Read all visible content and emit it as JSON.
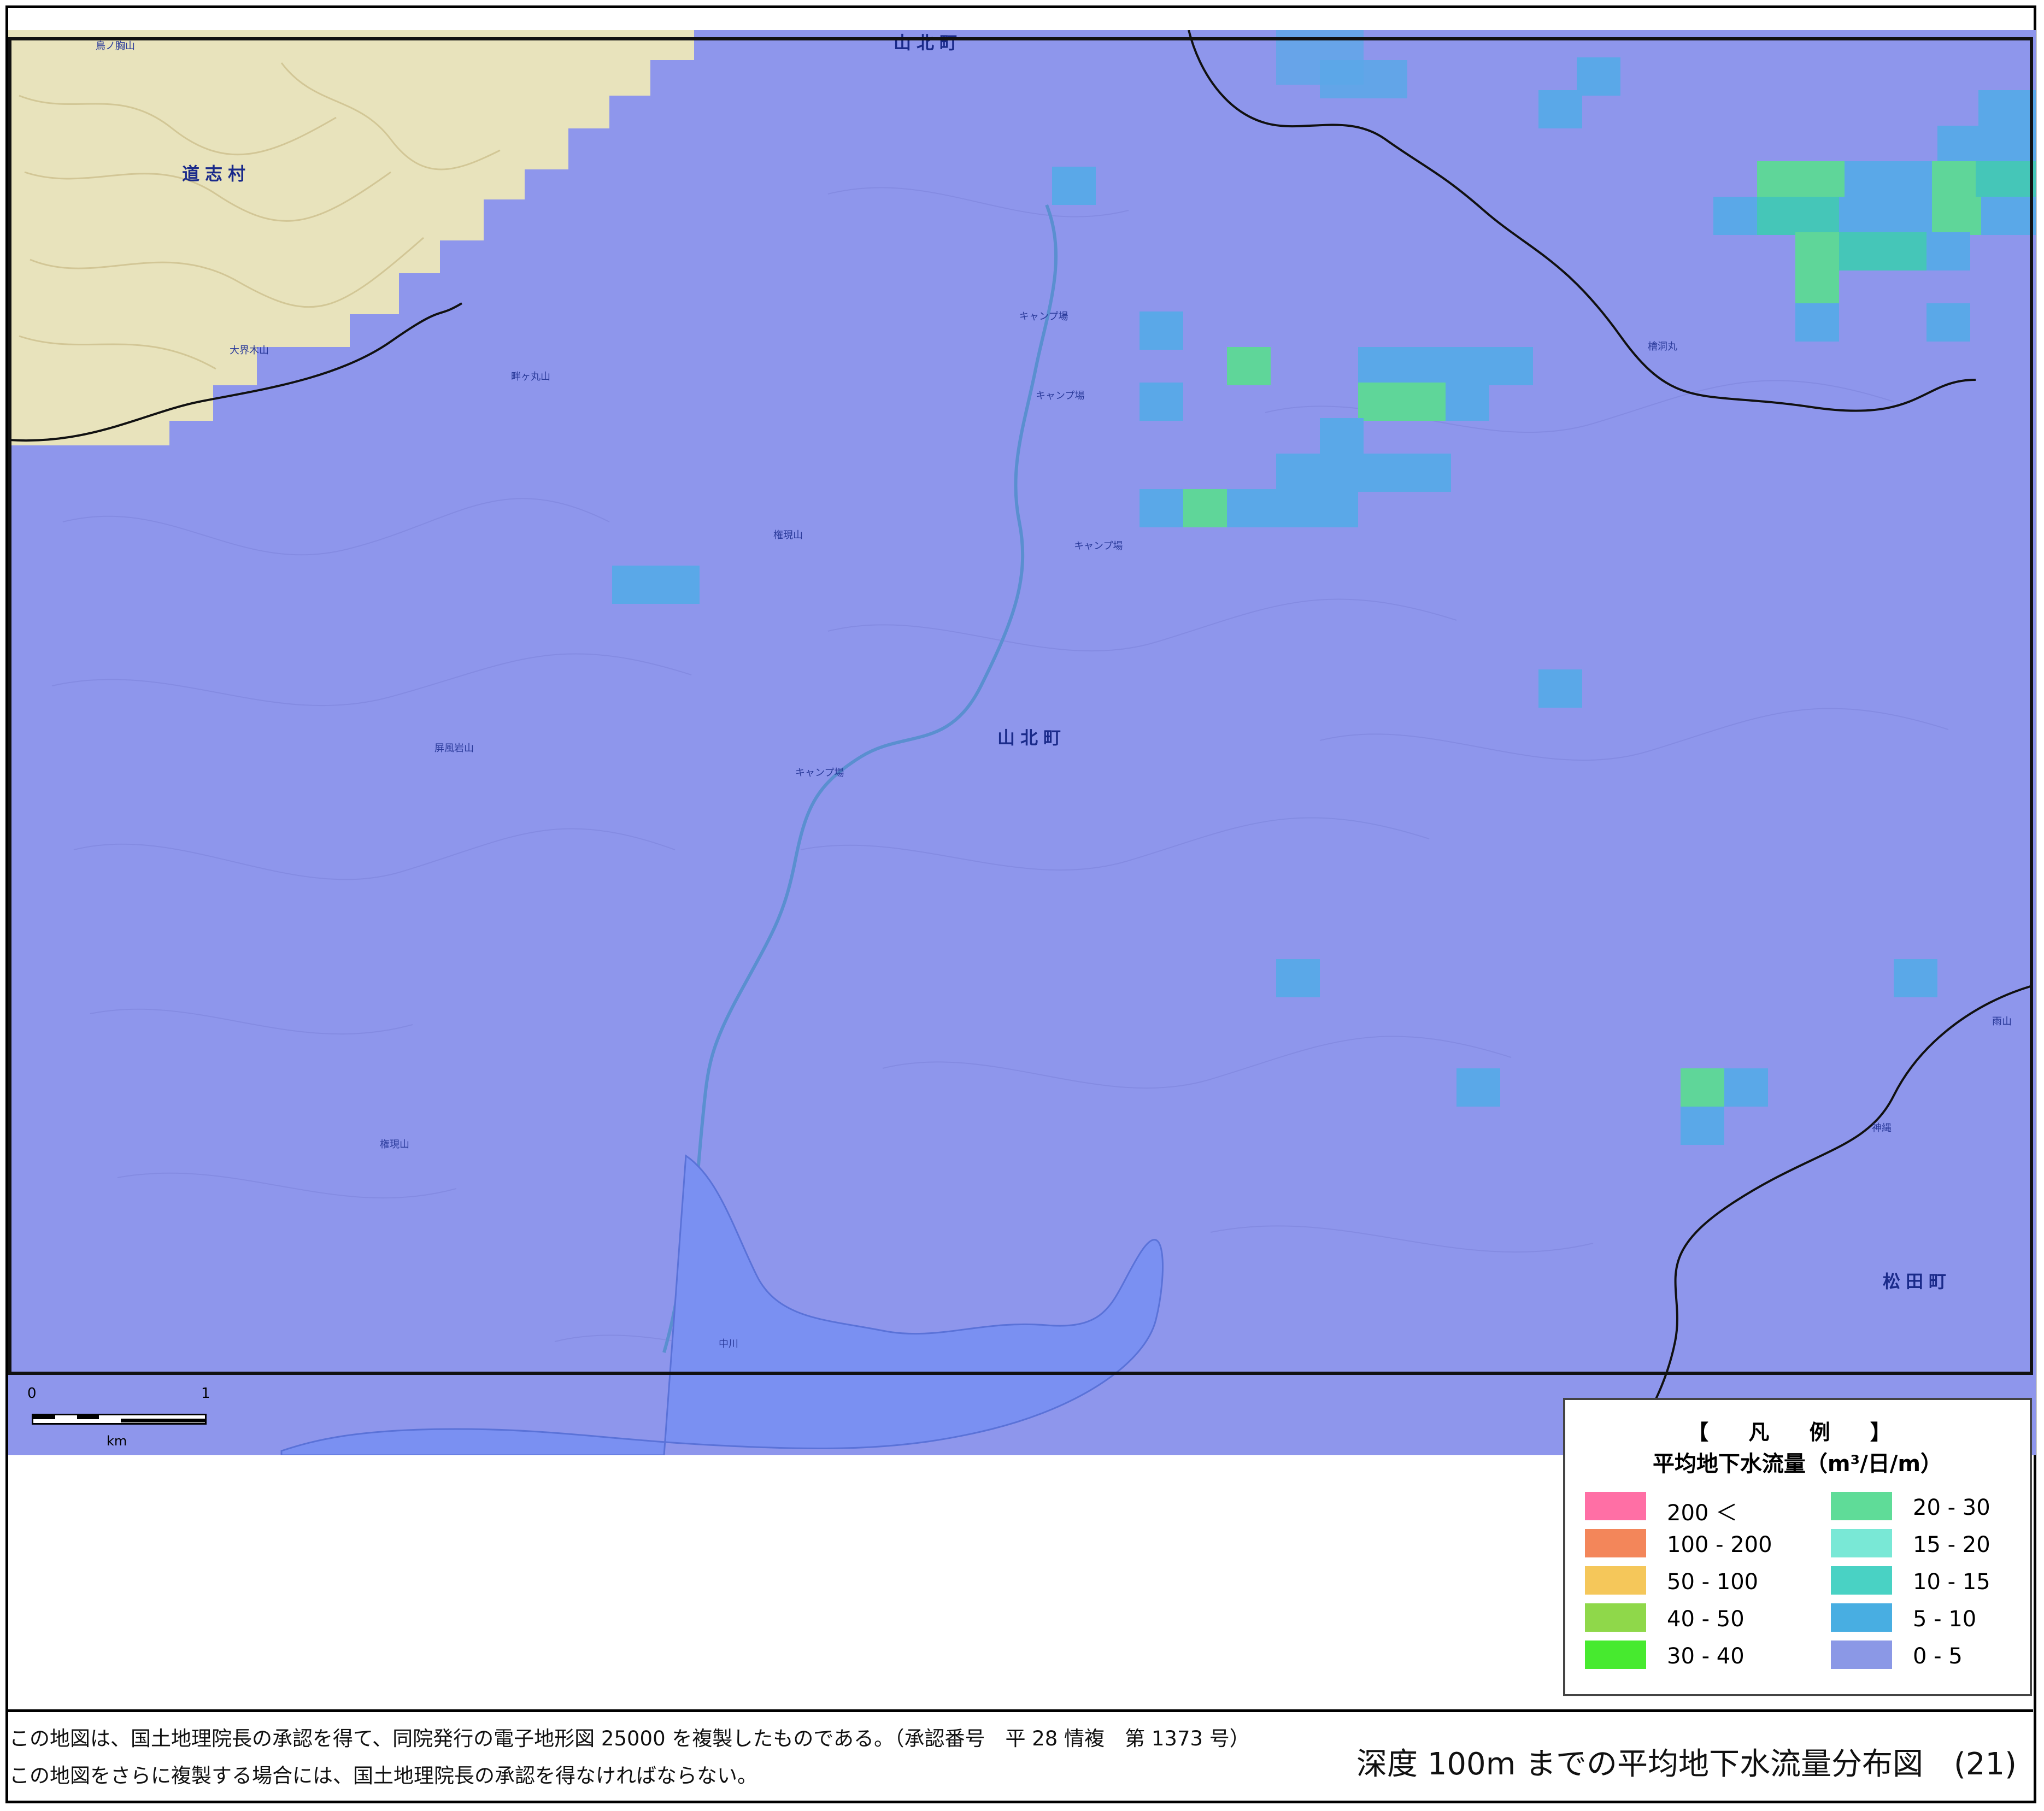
{
  "map": {
    "municipalities": {
      "doshi": "道志村",
      "sanhoku_top": "山北町",
      "sanhoku_center": "山北町",
      "matsuda": "松田町"
    },
    "place_names": [
      "鳥ノ胸山",
      "大界木山",
      "畔ヶ丸山",
      "権現山",
      "屏風岩山",
      "権現山",
      "キャンプ場",
      "キャンプ場",
      "キャンプ場",
      "キャンプ場",
      "檜洞丸",
      "雨山",
      "神縄",
      "中川"
    ],
    "colors": {
      "background_class": "#8e96ec",
      "outside_area": "#e8e3bc",
      "class_5_10": "#5aa8e8",
      "class_10_15": "#45c6b8",
      "class_20_30": "#5fd699",
      "water": "#7e94f0"
    }
  },
  "scale": {
    "zero": "0",
    "one": "1",
    "unit": "km"
  },
  "legend": {
    "title": "【 凡 例 】",
    "subtitle": "平均地下水流量（m³/日/m）",
    "items": [
      {
        "label": "200 ＜",
        "color": "#ff6fa5"
      },
      {
        "label": "100 - 200",
        "color": "#f3865a"
      },
      {
        "label": "50 - 100",
        "color": "#f5c75a"
      },
      {
        "label": "40 - 50",
        "color": "#8fd84a"
      },
      {
        "label": "30 - 40",
        "color": "#47ea2f"
      },
      {
        "label": "20 - 30",
        "color": "#5fdc98"
      },
      {
        "label": "15 - 20",
        "color": "#79e8d6"
      },
      {
        "label": "10 - 15",
        "color": "#49d2c4"
      },
      {
        "label": "5 - 10",
        "color": "#48aee2"
      },
      {
        "label": "0 - 5",
        "color": "#8b98e6"
      }
    ]
  },
  "footer": {
    "note1": "この地図は、国土地理院長の承認を得て、同院発行の電子地形図 25000 を複製したものである。（承認番号　平 28 情複　第 1373 号）",
    "note2": "この地図をさらに複製する場合には、国土地理院長の承認を得なければならない。",
    "title": "深度 100m までの平均地下水流量分布図　(21)"
  }
}
